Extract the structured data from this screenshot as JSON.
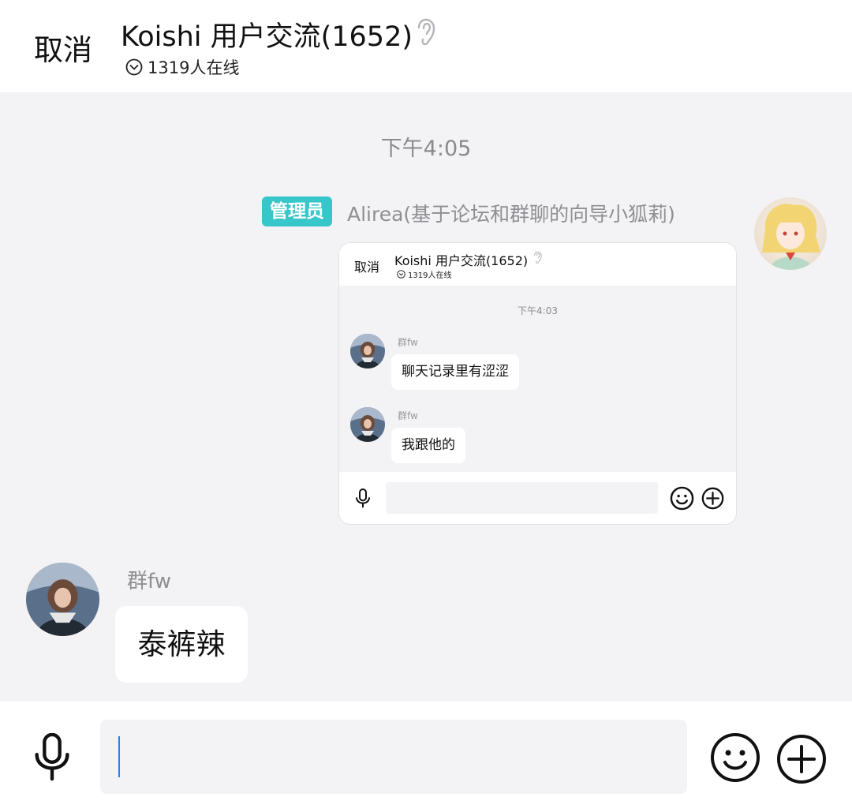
{
  "header": {
    "cancel_label": "取消",
    "title": "Koishi 用户交流(1652)",
    "online_text": "1319人在线"
  },
  "chat": {
    "timestamp": "下午4:05",
    "messages": [
      {
        "side": "right",
        "badge": "管理员",
        "sender": "Alirea(基于论坛和群聊的向导小狐莉)",
        "type": "image",
        "image": {
          "header": {
            "cancel_label": "取消",
            "title": "Koishi 用户交流(1652)",
            "online_text": "1319人在线"
          },
          "timestamp": "下午4:03",
          "messages": [
            {
              "sender": "群fw",
              "text": "聊天记录里有涩涩"
            },
            {
              "sender": "群fw",
              "text": "我跟他的"
            }
          ]
        }
      },
      {
        "side": "left",
        "sender": "群fw",
        "text": "泰裤辣"
      }
    ]
  },
  "input": {
    "value": "",
    "icons": [
      "microphone-icon",
      "emoji-icon",
      "plus-icon"
    ]
  },
  "colors": {
    "accent_badge": "#37c6c9",
    "background": "#f3f2f5",
    "caret": "#1e88e5"
  }
}
